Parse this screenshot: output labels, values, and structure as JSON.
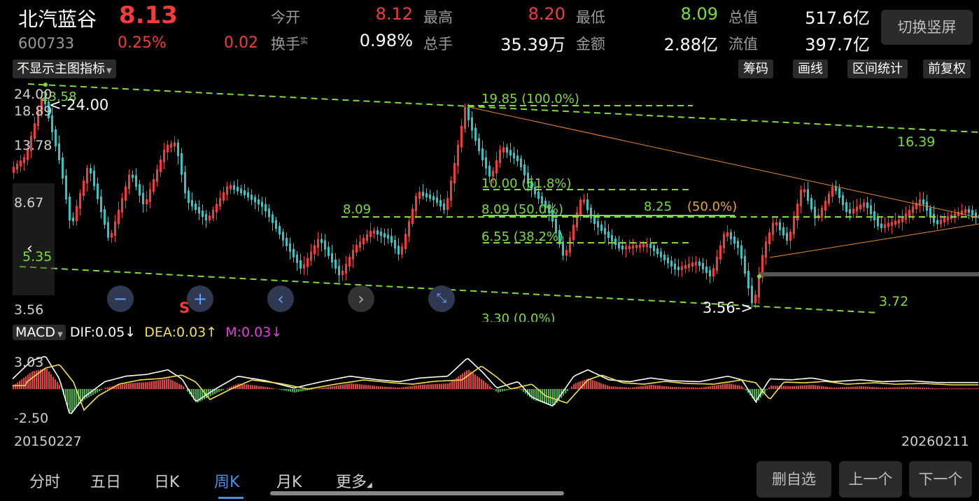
{
  "stock": {
    "name": "北汽蓝谷",
    "price": "8.13",
    "code": "600733",
    "change_pct": "0.25%",
    "change": "0.02"
  },
  "quote": {
    "open_label": "今开",
    "open": "8.12",
    "high_label": "最高",
    "high": "8.20",
    "low_label": "最低",
    "low": "8.09",
    "mcap_label": "总值",
    "mcap": "517.6亿",
    "turnover_label": "换手",
    "turnover_sup": "实",
    "turnover": "0.98%",
    "volume_label": "总手",
    "volume": "35.39万",
    "amount_label": "金额",
    "amount": "2.88亿",
    "float_label": "流值",
    "float_mcap": "397.7亿"
  },
  "switch_button": "切换竖屏",
  "indicator_dropdown": "不显示主图指标",
  "tools": [
    "筹码",
    "画线",
    "区间统计",
    "前复权"
  ],
  "y_axis": [
    "24.00",
    "18.89",
    "13.78",
    "8.67",
    "5.35",
    "3.56"
  ],
  "annotations": {
    "max_label": "<-24.00",
    "max_top_val": "23.58",
    "min_label": "3.56->",
    "fib_100": "19.85 (100.0%)",
    "fib_618": "10.00 (61.8%)",
    "fib_50": "8.09 (50.0%)",
    "fib_382": "6.55 (38.2%)",
    "fib_0": "3.30 (0.0%)",
    "level_left": "8.09",
    "level_mid": "8.25",
    "level_mid_overlap": "(50.0%)",
    "channel_top": "16.39",
    "channel_bottom": "3.72"
  },
  "macd": {
    "name": "MACD",
    "dif": "DIF:0.05",
    "dea": "DEA:0.03",
    "m": "M:0.03",
    "dif_arrow": "↓",
    "dea_arrow": "↑",
    "m_arrow": "↓",
    "y_top": "3.03",
    "y_bottom": "-2.50"
  },
  "dates": {
    "start": "20150227",
    "end": "20260211"
  },
  "tabs": [
    "分时",
    "五日",
    "日K",
    "周K",
    "月K",
    "更多"
  ],
  "active_tab": "周K",
  "bottom_buttons": [
    "删自选",
    "上一个",
    "下一个"
  ],
  "colors": {
    "up": "#f23c3c",
    "down": "#35c4c4",
    "fib": "#7ddc3a",
    "dif": "#ffffff",
    "dea": "#f3e24a",
    "m": "#e040e0",
    "active": "#4a90e2"
  },
  "icons": {
    "zoom_out": "minus-icon",
    "zoom_in": "plus-icon",
    "prev": "chevron-left-icon",
    "next": "chevron-right-icon",
    "fullscreen": "collapse-icon",
    "s_marker": "s-marker"
  }
}
